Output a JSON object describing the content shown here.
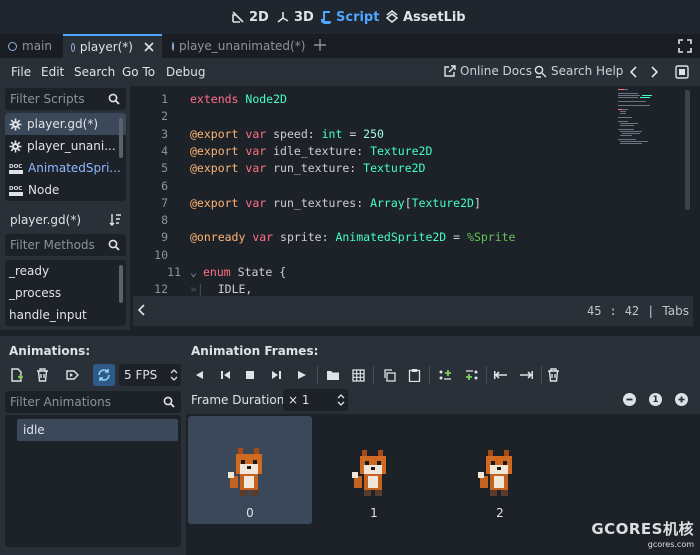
{
  "workspaces": {
    "twod": "2D",
    "threed": "3D",
    "script": "Script",
    "assetlib": "AssetLib"
  },
  "tabs": [
    {
      "label": "main"
    },
    {
      "label": "player(*)"
    },
    {
      "label": "playe_unanimated(*)"
    }
  ],
  "menu": {
    "file": "File",
    "edit": "Edit",
    "search": "Search",
    "goto": "Go To",
    "debug": "Debug",
    "online_docs": "Online Docs",
    "search_help": "Search Help"
  },
  "scripts": {
    "filter_placeholder": "Filter Scripts",
    "items": [
      {
        "label": "player.gd(*)"
      },
      {
        "label": "player_unani..."
      },
      {
        "label": "AnimatedSpri..."
      },
      {
        "label": "Node"
      }
    ],
    "current_file": "player.gd(*)",
    "methods_placeholder": "Filter Methods",
    "methods": [
      {
        "label": "_ready"
      },
      {
        "label": "_process"
      },
      {
        "label": "handle_input"
      }
    ]
  },
  "code": {
    "line_numbers": [
      "1",
      "2",
      "3",
      "4",
      "5",
      "6",
      "7",
      "8",
      "9",
      "10",
      "11",
      "12"
    ],
    "status": {
      "line": "45",
      "col": "42",
      "indent": "Tabs",
      "sep": ":"
    }
  },
  "animation": {
    "animations_label": "Animations:",
    "frames_label": "Animation Frames:",
    "fps_value": "5 FPS",
    "filter_placeholder": "Filter Animations",
    "items": [
      {
        "label": "idle"
      }
    ],
    "frame_duration_label": "Frame Duration:",
    "frame_duration_value": "× 1",
    "zoom_value": "1",
    "frames": [
      {
        "label": "0"
      },
      {
        "label": "1"
      },
      {
        "label": "2"
      }
    ]
  },
  "watermark": {
    "brand": "GCORES机核",
    "url": "gcores.com"
  },
  "colors": {
    "accent": "#4ea6ff",
    "keyword": "#ff7085",
    "type": "#42ffc2",
    "number": "#a1ffe0",
    "annotation": "#ffb373",
    "nodepath": "#63c259"
  }
}
